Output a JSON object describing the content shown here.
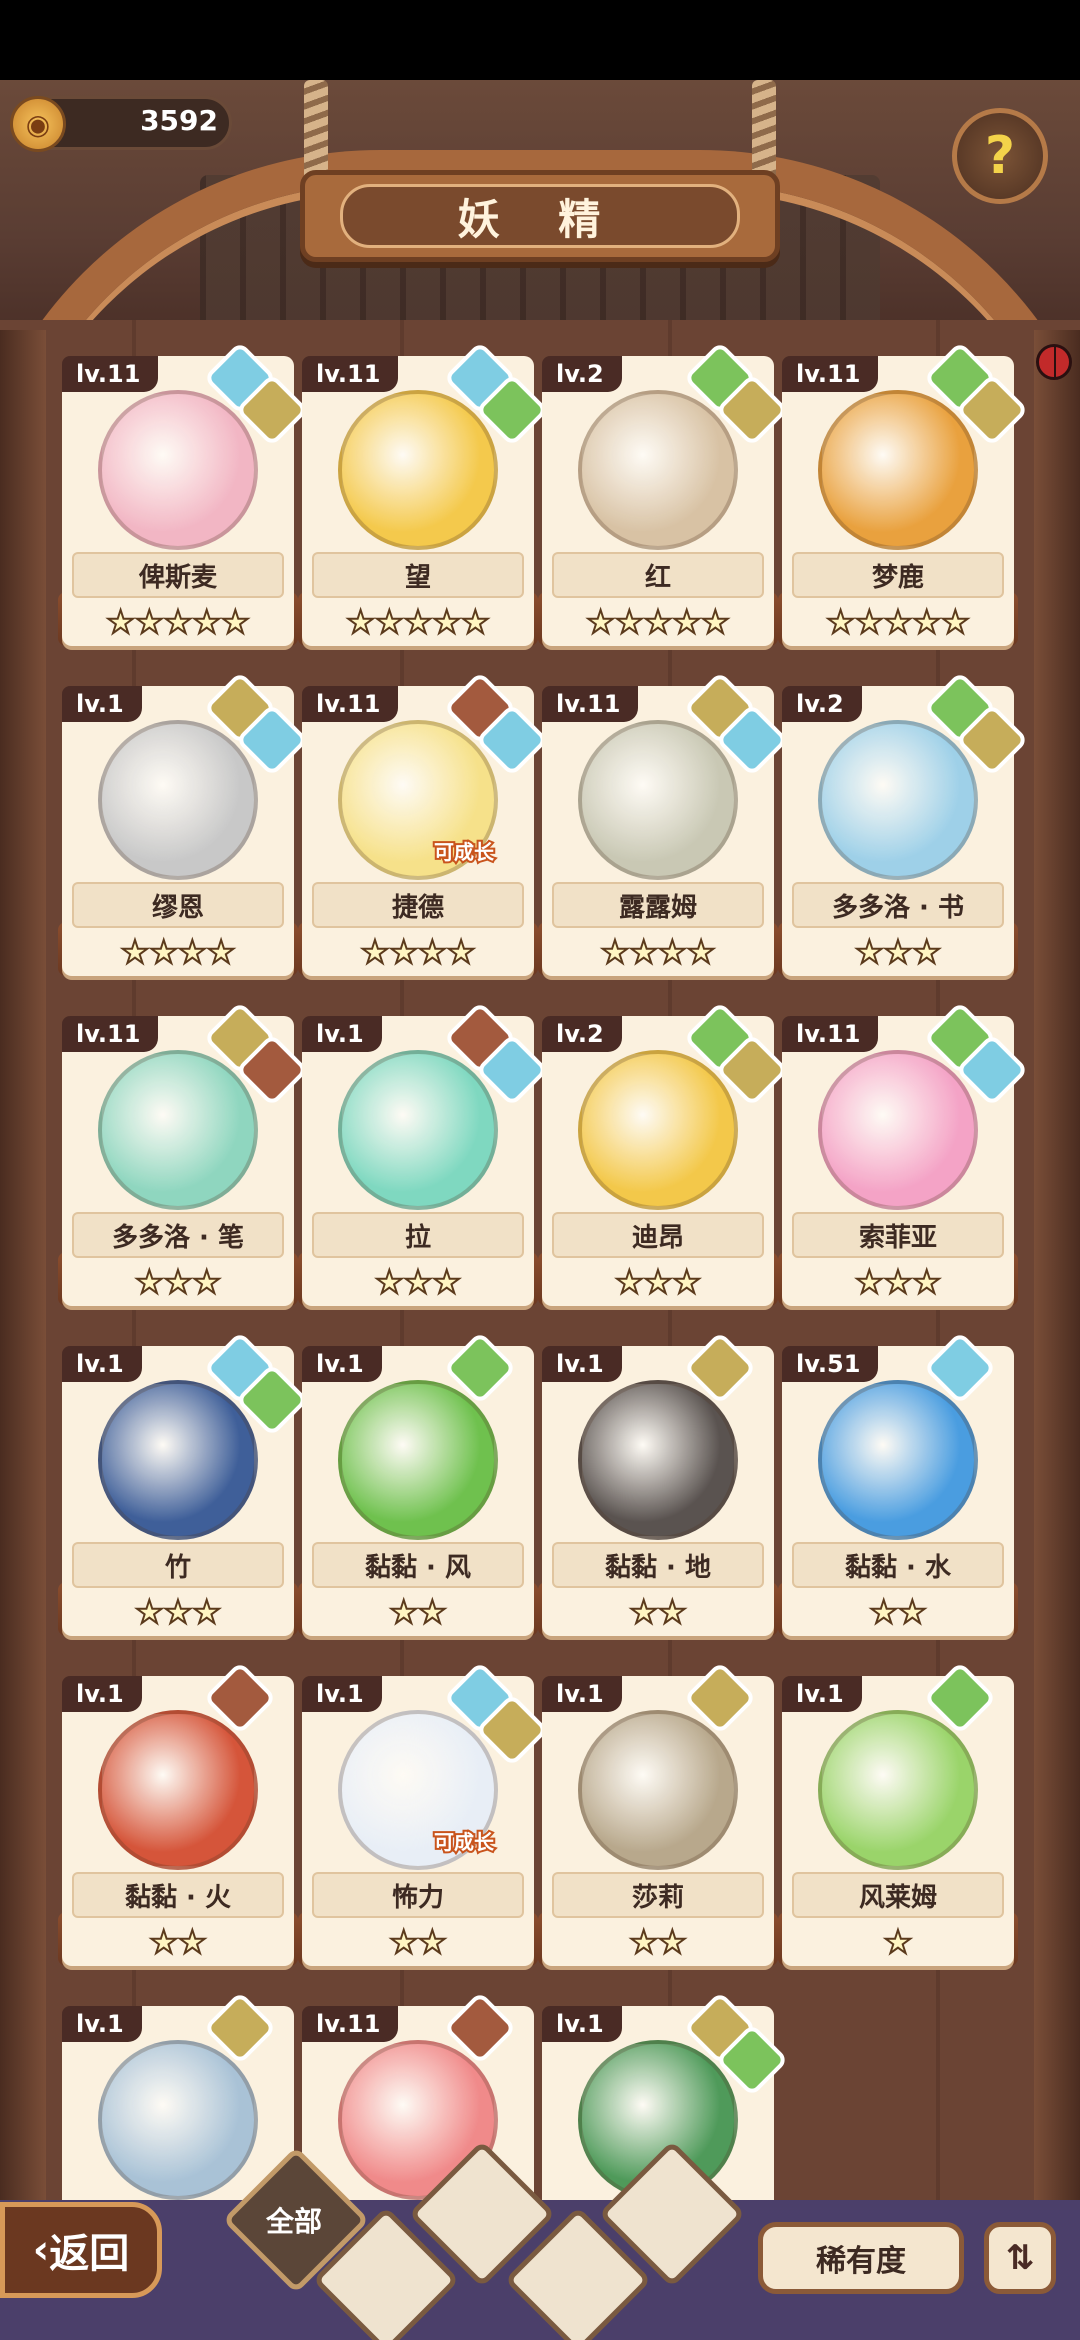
{
  "header": {
    "title": "妖 精",
    "coins": "3592"
  },
  "nav": {
    "back_label": "返回",
    "filter_all_label": "全部",
    "rarity_label": "稀有度"
  },
  "cards": [
    {
      "level": "lv.11",
      "name": "俾斯麦",
      "stars": "★★★★★",
      "portrait_color": "#f2b6c4",
      "elements": [
        "water",
        "earth"
      ],
      "grow": ""
    },
    {
      "level": "lv.11",
      "name": "望",
      "stars": "★★★★★",
      "portrait_color": "#f4c94c",
      "elements": [
        "water",
        "wind"
      ],
      "grow": ""
    },
    {
      "level": "lv.2",
      "name": "红",
      "stars": "★★★★★",
      "portrait_color": "#d8c2a4",
      "elements": [
        "wind",
        "earth"
      ],
      "grow": ""
    },
    {
      "level": "lv.11",
      "name": "梦鹿",
      "stars": "★★★★★",
      "portrait_color": "#e9a13e",
      "elements": [
        "wind",
        "earth"
      ],
      "grow": ""
    },
    {
      "level": "lv.1",
      "name": "缪恩",
      "stars": "★★★★",
      "portrait_color": "#c8c8c8",
      "elements": [
        "earth",
        "water"
      ],
      "grow": ""
    },
    {
      "level": "lv.11",
      "name": "捷德",
      "stars": "★★★★",
      "portrait_color": "#f6e18a",
      "elements": [
        "fire",
        "water"
      ],
      "grow": "可成长"
    },
    {
      "level": "lv.11",
      "name": "露露姆",
      "stars": "★★★★",
      "portrait_color": "#c9c8b4",
      "elements": [
        "earth",
        "water"
      ],
      "grow": ""
    },
    {
      "level": "lv.2",
      "name": "多多洛 · 书",
      "stars": "★★★",
      "portrait_color": "#9ed0e8",
      "elements": [
        "wind",
        "earth"
      ],
      "grow": ""
    },
    {
      "level": "lv.11",
      "name": "多多洛 · 笔",
      "stars": "★★★",
      "portrait_color": "#8fd6bf",
      "elements": [
        "earth",
        "fire"
      ],
      "grow": ""
    },
    {
      "level": "lv.1",
      "name": "拉",
      "stars": "★★★",
      "portrait_color": "#7fd8c0",
      "elements": [
        "fire",
        "water"
      ],
      "grow": ""
    },
    {
      "level": "lv.2",
      "name": "迪昂",
      "stars": "★★★",
      "portrait_color": "#f3c84a",
      "elements": [
        "wind",
        "earth"
      ],
      "grow": ""
    },
    {
      "level": "lv.11",
      "name": "索菲亚",
      "stars": "★★★",
      "portrait_color": "#f4a3c6",
      "elements": [
        "wind",
        "water"
      ],
      "grow": ""
    },
    {
      "level": "lv.1",
      "name": "竹",
      "stars": "★★★",
      "portrait_color": "#3f5f99",
      "elements": [
        "water",
        "wind"
      ],
      "grow": ""
    },
    {
      "level": "lv.1",
      "name": "黏黏 · 风",
      "stars": "★★",
      "portrait_color": "#6fc14e",
      "elements": [
        "wind"
      ],
      "grow": ""
    },
    {
      "level": "lv.1",
      "name": "黏黏 · 地",
      "stars": "★★",
      "portrait_color": "#5a5350",
      "elements": [
        "earth"
      ],
      "grow": ""
    },
    {
      "level": "lv.51",
      "name": "黏黏 · 水",
      "stars": "★★",
      "portrait_color": "#4a9de0",
      "elements": [
        "water"
      ],
      "grow": ""
    },
    {
      "level": "lv.1",
      "name": "黏黏 · 火",
      "stars": "★★",
      "portrait_color": "#d5553a",
      "elements": [
        "fire"
      ],
      "grow": ""
    },
    {
      "level": "lv.1",
      "name": "怖力",
      "stars": "★★",
      "portrait_color": "#e8eef6",
      "elements": [
        "water",
        "earth"
      ],
      "grow": "可成长"
    },
    {
      "level": "lv.1",
      "name": "莎莉",
      "stars": "★★",
      "portrait_color": "#b8a88c",
      "elements": [
        "earth"
      ],
      "grow": ""
    },
    {
      "level": "lv.1",
      "name": "风莱姆",
      "stars": "★",
      "portrait_color": "#9ad46a",
      "elements": [
        "wind"
      ],
      "grow": ""
    },
    {
      "level": "lv.1",
      "name": "",
      "stars": "",
      "portrait_color": "#a9c2d6",
      "elements": [
        "earth"
      ],
      "grow": ""
    },
    {
      "level": "lv.11",
      "name": "",
      "stars": "",
      "portrait_color": "#f08a8a",
      "elements": [
        "fire"
      ],
      "grow": ""
    },
    {
      "level": "lv.1",
      "name": "",
      "stars": "",
      "portrait_color": "#4f9a5a",
      "elements": [
        "earth",
        "wind"
      ],
      "grow": ""
    }
  ],
  "colors": {
    "wood": "#6b4434",
    "card": "#fbf1df",
    "level_tag": "#4a2b25",
    "bottom_bar": "#4b3f6a",
    "water": "#7fcde3",
    "earth": "#c6ad5a",
    "wind": "#7cc35c",
    "fire": "#a35a3e"
  },
  "icons": {
    "coin": "coin-icon",
    "help": "question-sprout-icon",
    "sort": "sort-icon",
    "back": "chevron-left-icon"
  }
}
